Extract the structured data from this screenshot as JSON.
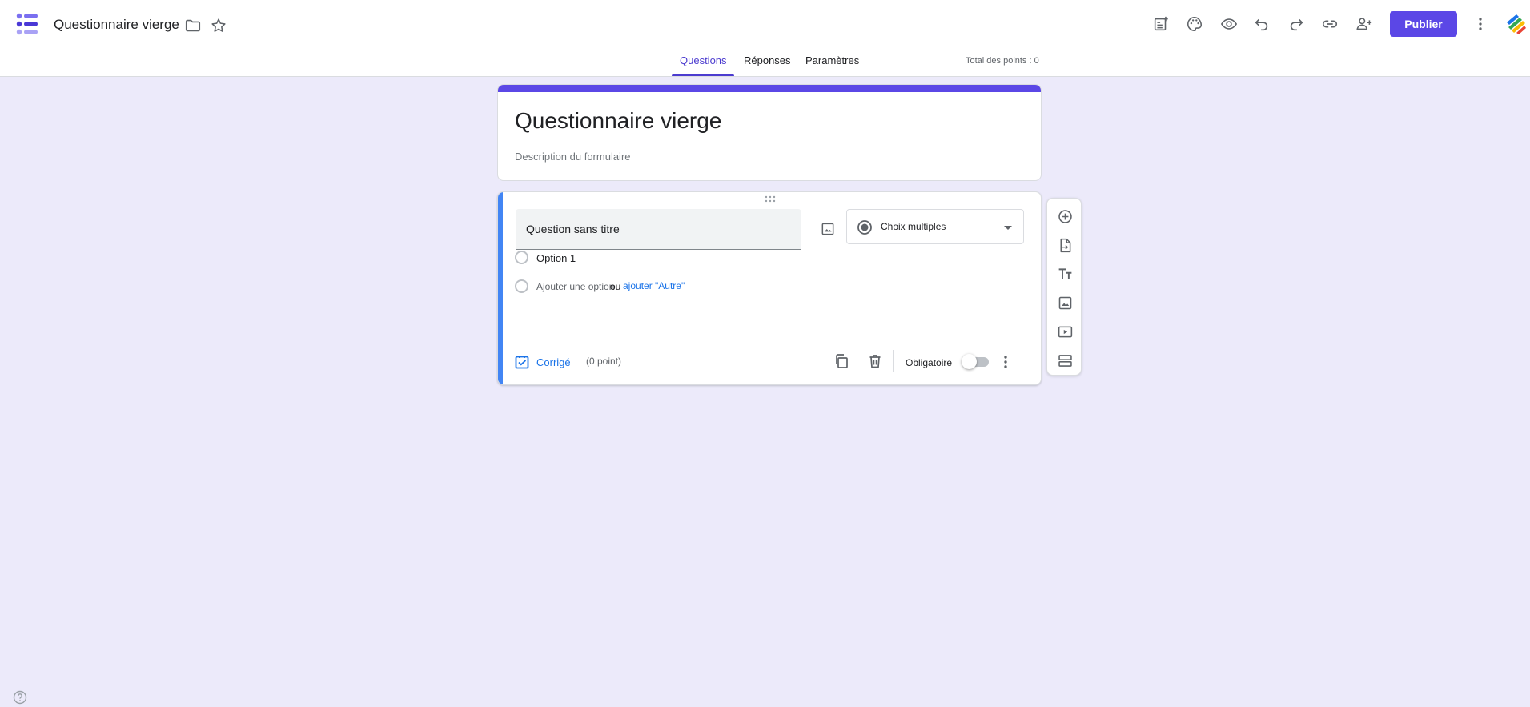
{
  "header": {
    "doc_title": "Questionnaire vierge",
    "publish_label": "Publier"
  },
  "tabs": [
    {
      "label": "Questions",
      "active": true
    },
    {
      "label": "Réponses",
      "active": false
    },
    {
      "label": "Paramètres",
      "active": false
    }
  ],
  "points_total": "Total des points : 0",
  "form": {
    "title": "Questionnaire vierge",
    "description_placeholder": "Description du formulaire"
  },
  "question": {
    "title_placeholder": "Question sans titre",
    "type_label": "Choix multiples",
    "options": [
      "Option 1"
    ],
    "add_option_label": "Ajouter une option",
    "or_label": "ou",
    "add_other_label": "ajouter \"Autre\"",
    "answer_key_label": "Corrigé",
    "points_label": "(0 point)",
    "required_label": "Obligatoire",
    "required_on": false
  },
  "side_toolbar": {
    "items": [
      "add-question",
      "import-questions",
      "add-title-description",
      "add-image",
      "add-video",
      "add-section"
    ]
  },
  "colors": {
    "accent": "#5b47e6",
    "tab_active": "#4b3bcf",
    "question_stripe": "#4285f4",
    "link_blue": "#1a73e8",
    "page_bg": "#eceafa"
  }
}
